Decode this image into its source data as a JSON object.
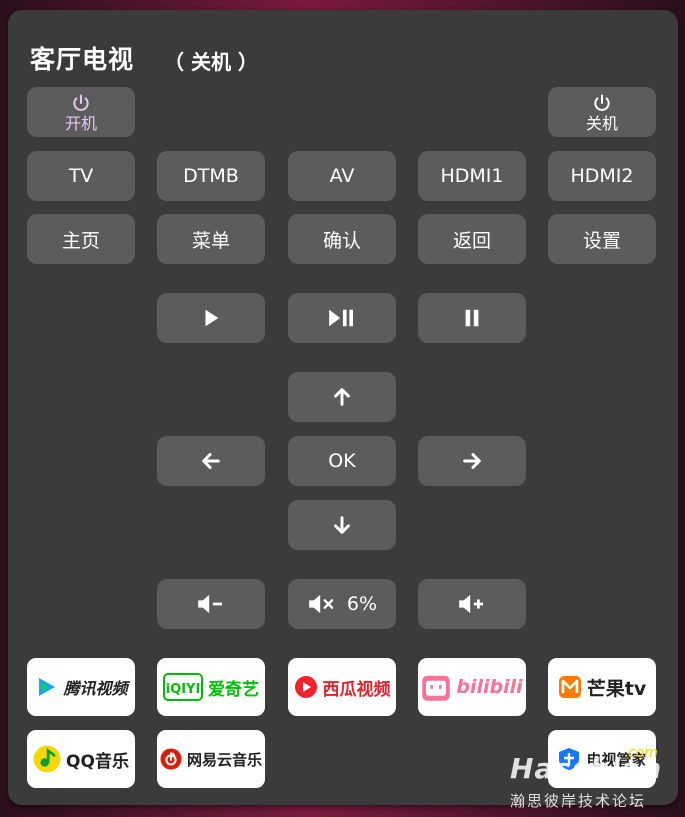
{
  "header": {
    "title": "客厅电视",
    "state": "（ 关机 ）"
  },
  "power": {
    "on_label": "开机",
    "off_label": "关机"
  },
  "sources": [
    "TV",
    "DTMB",
    "AV",
    "HDMI1",
    "HDMI2"
  ],
  "functions": [
    "主页",
    "菜单",
    "确认",
    "返回",
    "设置"
  ],
  "dpad": {
    "ok_label": "OK"
  },
  "volume": {
    "level": "6%"
  },
  "apps": [
    "腾讯视频",
    "爱奇艺",
    "西瓜视频",
    "bilibili",
    "芒果tv",
    "QQ音乐",
    "网易云音乐",
    "电视管家"
  ],
  "app_colors": {
    "tencent": "#1aa5f5",
    "iqiyi": "#00be06",
    "xigua": "#f5222d",
    "bilibili": "#fb7299",
    "mango": "#ff7a00",
    "qqmusic": "#f5d800",
    "netease": "#d81e06",
    "tvguard": "#1677ff"
  },
  "watermark": {
    "brand": "Hassbian",
    "suffix": "com",
    "caption": "瀚思彼岸技术论坛"
  }
}
